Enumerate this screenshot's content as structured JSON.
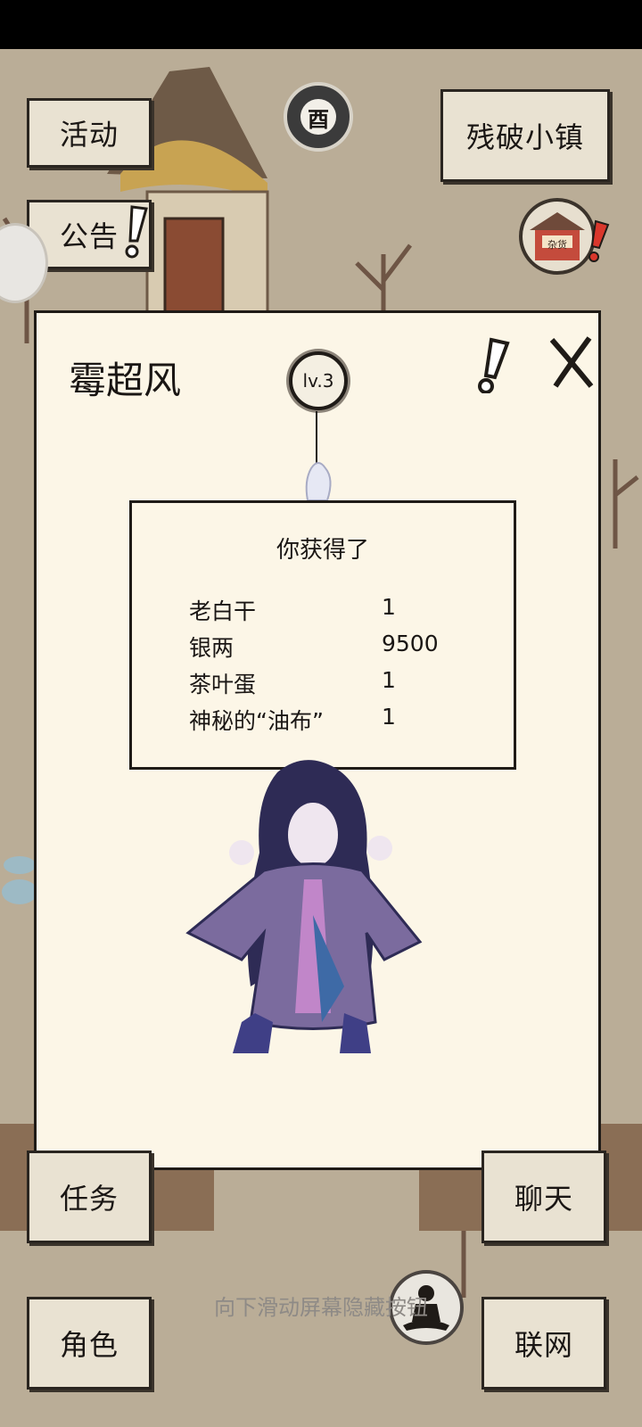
{
  "status_bar": {},
  "top_left_buttons": {
    "activity": "活动",
    "notice": "公告"
  },
  "time_badge": {
    "glyph": "酉"
  },
  "location": {
    "label": "残破小镇"
  },
  "shop_badge": {
    "label": "杂货",
    "icon": "shop-icon"
  },
  "npc_panel": {
    "title": "霉超风",
    "level": "lv.3",
    "reward": {
      "title": "你获得了",
      "items": [
        {
          "name": "老白干",
          "qty": "1"
        },
        {
          "name": "银两",
          "qty": "9500"
        },
        {
          "name": "茶叶蛋",
          "qty": "1"
        },
        {
          "name": "神秘的“油布”",
          "qty": "1"
        }
      ]
    }
  },
  "bottom_buttons": {
    "quest": "任务",
    "chat": "聊天",
    "character": "角色",
    "online": "联网"
  },
  "meditate": {
    "icon": "meditate-icon"
  },
  "hint_text": "向下滑动屏幕隐藏按钮",
  "colors": {
    "panel_bg": "#fcf6e7",
    "button_bg": "#e9e2d2",
    "ink": "#1f1b17",
    "ground": "#b9ab95"
  }
}
